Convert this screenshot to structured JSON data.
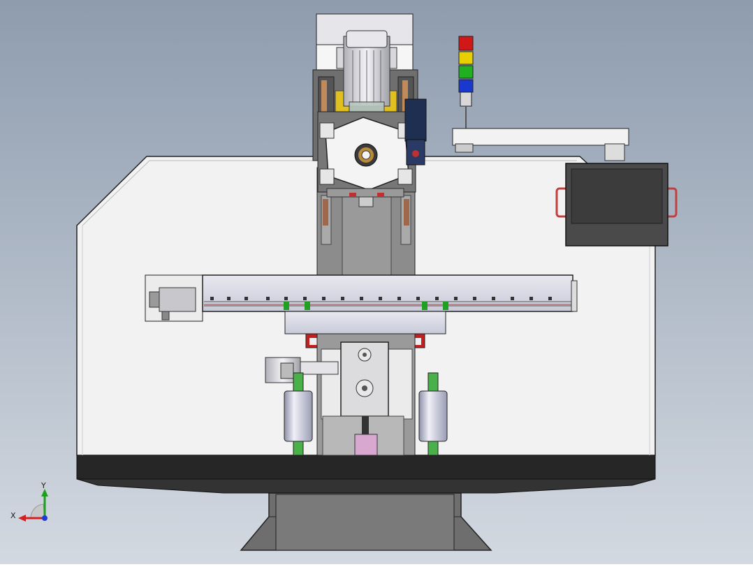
{
  "scene": {
    "description_type": "cad-viewport",
    "background_top": "#8e9cae",
    "background_bottom": "#d3d9e1"
  },
  "triad": {
    "x_label": "X",
    "y_label": "Y",
    "x_color": "#d42020",
    "y_color": "#1ea01e",
    "z_color": "#1e3cd4"
  },
  "stack_light": {
    "colors": [
      "#d01818",
      "#e8d000",
      "#20b020",
      "#1838d0"
    ]
  }
}
